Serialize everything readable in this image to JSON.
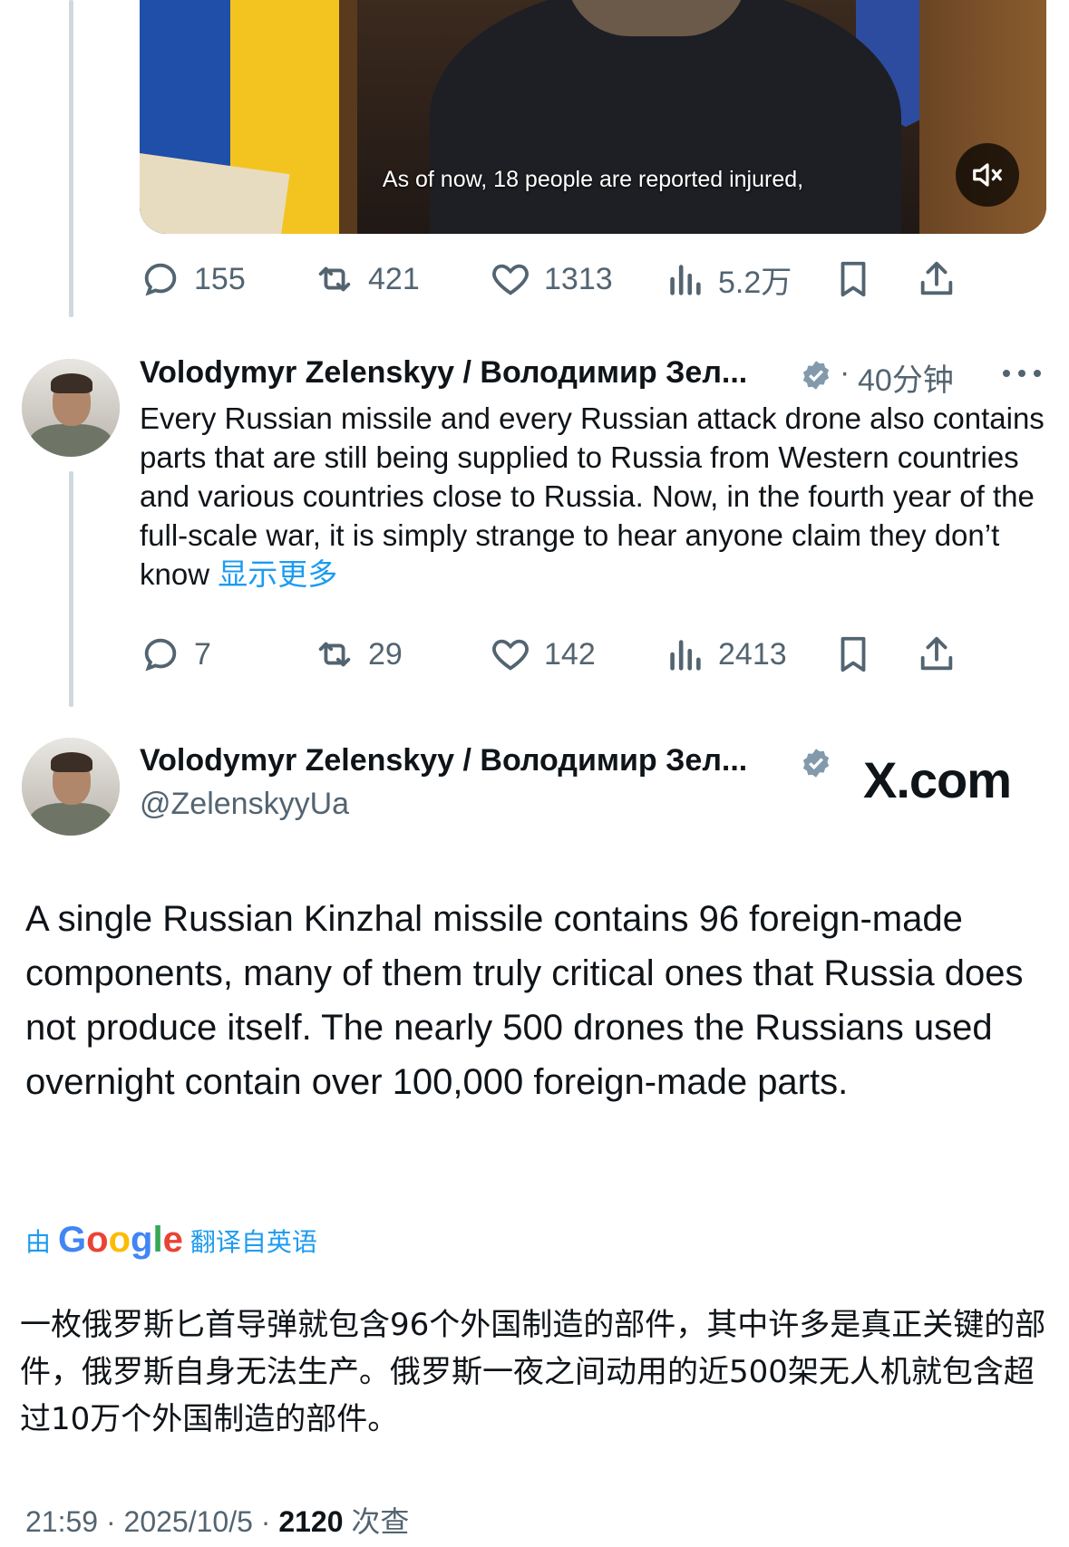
{
  "video": {
    "subtitle": "As of now, 18 people are reported injured,",
    "mute_icon": "speaker-muted-icon"
  },
  "tweet1_actions": {
    "replies": "155",
    "retweets": "421",
    "likes": "1313",
    "views": "5.2万"
  },
  "tweet2": {
    "author_name": "Volodymyr Zelenskyy / Володимир Зел...",
    "time": "40分钟",
    "separator": "·",
    "text": "Every Russian missile and every Russian attack drone also contains parts that are still being supplied to Russia from Western countries and various countries close to Russia. Now, in the fourth year of the full-scale war, it is simply strange to hear anyone claim they don’t know",
    "show_more": "显示更多",
    "replies": "7",
    "retweets": "29",
    "likes": "142",
    "views": "2413"
  },
  "main_tweet": {
    "author_name": "Volodymyr Zelenskyy / Володимир Зел...",
    "handle": "@ZelenskyyUa",
    "text": "A single Russian Kinzhal missile contains 96 foreign-made components, many of them truly critical ones that Russia does not produce itself. The nearly 500 drones the Russians used overnight contain over 100,000 foreign-made parts.",
    "translated_prefix": "由",
    "translated_logo": "Google",
    "translated_suffix": "翻译自英语",
    "translation": "一枚俄罗斯匕首导弹就包含96个外国制造的部件，其中许多是真正关键的部件，俄罗斯自身无法生产。俄罗斯一夜之间动用的近500架无人机就包含超过10万个外国制造的部件。",
    "time": "21:59",
    "date": "2025/10/5",
    "views": "2120",
    "views_label": "次查"
  },
  "watermark": "X.com",
  "colors": {
    "accent": "#1d9bf0",
    "muted_text": "#536471",
    "thread_line": "#cfd9de",
    "verified": "#829aab"
  }
}
